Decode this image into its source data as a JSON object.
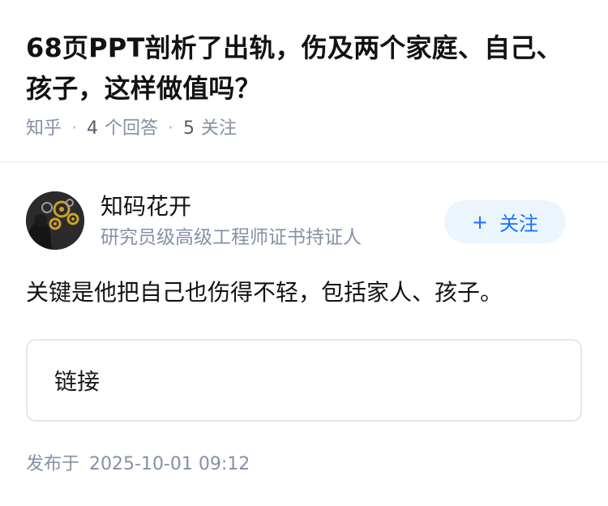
{
  "question": {
    "title": "68页PPT剖析了出轨，伤及两个家庭、自己、孩子，这样做值吗？",
    "source": "知乎",
    "answer_count": "4",
    "answer_label": "个回答",
    "follow_count": "5",
    "follow_label": "关注"
  },
  "author": {
    "name": "知码花开",
    "bio": "研究员级高级工程师证书持证人",
    "follow_button": {
      "plus": "+",
      "label": "关注"
    }
  },
  "answer": {
    "text": "关键是他把自己也伤得不轻，包括家人、孩子。",
    "link_card_label": "链接"
  },
  "publish": {
    "label": "发布于",
    "time": "2025-10-01 09:12"
  },
  "colors": {
    "accent": "#1772f6",
    "accent_bg": "#ebf5fd",
    "meta": "#8590a6"
  }
}
